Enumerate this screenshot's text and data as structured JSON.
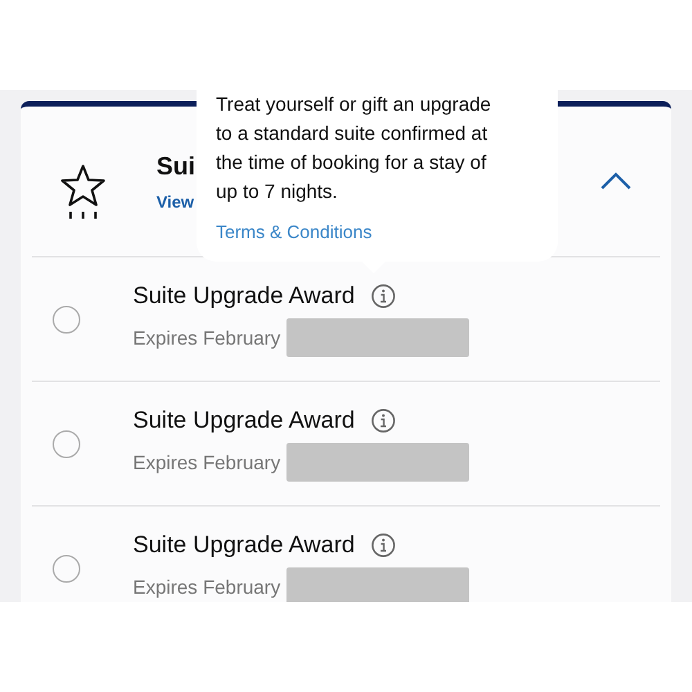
{
  "header": {
    "title": "Sui",
    "link": "View",
    "expanded": true
  },
  "tooltip": {
    "text": "Treat yourself or gift an upgrade to a standard suite confirmed at the time of booking for a stay of up to 7 nights.",
    "link": "Terms & Conditions"
  },
  "awards": [
    {
      "name": "Suite Upgrade Award",
      "expires": "Expires February",
      "selected": false
    },
    {
      "name": "Suite Upgrade Award",
      "expires": "Expires February",
      "selected": false
    },
    {
      "name": "Suite Upgrade Award",
      "expires": "Expires February",
      "selected": false
    }
  ]
}
